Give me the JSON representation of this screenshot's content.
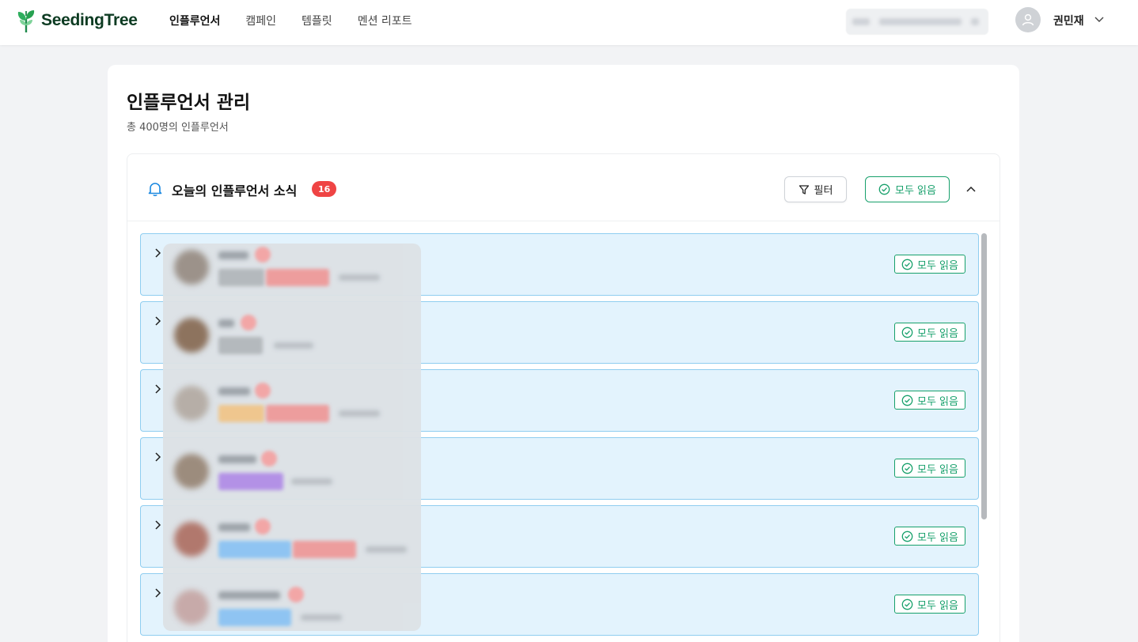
{
  "header": {
    "brand": "SeedingTree",
    "nav": [
      {
        "label": "인플루언서",
        "active": true
      },
      {
        "label": "캠페인",
        "active": false
      },
      {
        "label": "템플릿",
        "active": false
      },
      {
        "label": "멘션 리포트",
        "active": false
      }
    ],
    "user_name": "권민재"
  },
  "page": {
    "title": "인플루언서 관리",
    "subtitle": "총 400명의 인플루언서"
  },
  "news_panel": {
    "title": "오늘의 인플루언서 소식",
    "count": "16",
    "filter_label": "필터",
    "read_all_label": "모두 읽음",
    "rows": [
      {
        "read_label": "모두 읽음"
      },
      {
        "read_label": "모두 읽음"
      },
      {
        "read_label": "모두 읽음"
      },
      {
        "read_label": "모두 읽음"
      },
      {
        "read_label": "모두 읽음"
      },
      {
        "read_label": "모두 읽음"
      }
    ]
  },
  "colors": {
    "brand_green": "#17a06b",
    "row_bg": "#e3f3fd",
    "row_border": "#8fcdf0",
    "badge_red": "#ef4444"
  }
}
